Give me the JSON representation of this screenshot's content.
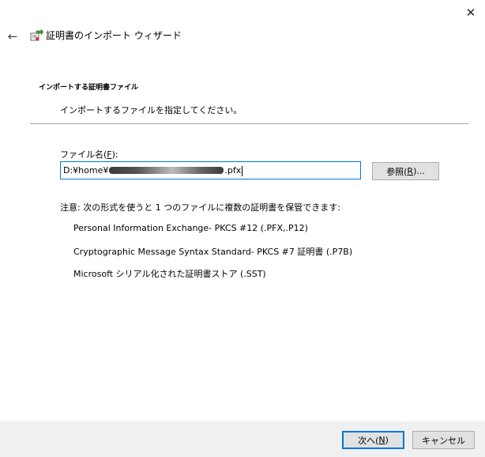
{
  "window": {
    "title": "証明書のインポート ウィザード",
    "close_glyph": "✕",
    "back_glyph": "←",
    "icons": {
      "close": "close-icon",
      "back": "arrow-left-icon",
      "wizard": "certificate-wizard-icon"
    }
  },
  "header": {
    "heading": "インポートする証明書ファイル",
    "subtitle": "インポートするファイルを指定してください。"
  },
  "file": {
    "label_prefix": "ファイル名(",
    "label_access_key": "F",
    "label_suffix": "):",
    "value_start": "D:¥home¥",
    "value_end": ".pfx",
    "browse_prefix": "参照(",
    "browse_access_key": "R",
    "browse_suffix": ")..."
  },
  "note": "注意: 次の形式を使うと 1 つのファイルに複数の証明書を保管できます:",
  "formats": [
    "Personal Information Exchange- PKCS #12 (.PFX,.P12)",
    "Cryptographic Message Syntax Standard- PKCS #7 証明書 (.P7B)",
    "Microsoft シリアル化された証明書ストア (.SST)"
  ],
  "footer": {
    "next_prefix": "次へ(",
    "next_access_key": "N",
    "next_suffix": ")",
    "cancel": "キャンセル"
  },
  "colors": {
    "accent": "#0078d7",
    "button_face": "#e1e1e1",
    "footer_bg": "#f0f0f0"
  }
}
